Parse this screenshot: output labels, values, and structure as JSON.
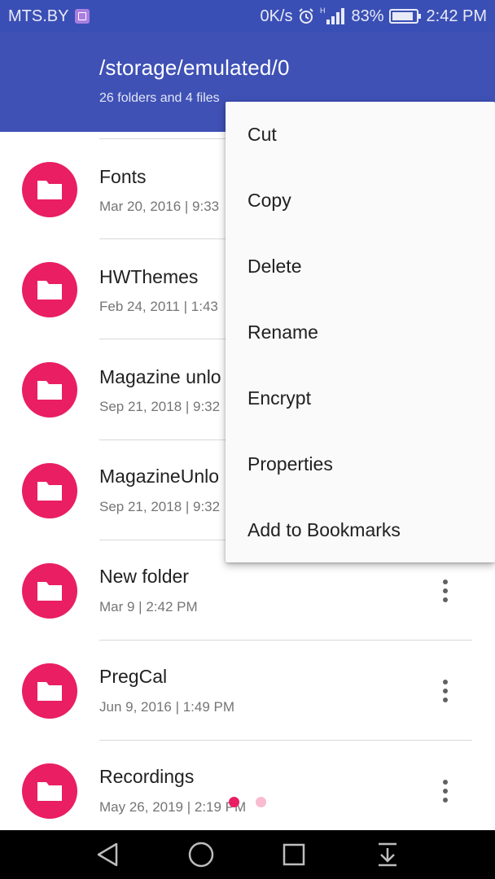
{
  "status_bar": {
    "carrier": "MTS.BY",
    "net_speed": "0K/s",
    "battery_percent": "83%",
    "time": "2:42 PM",
    "icons": [
      "gallery-icon",
      "alarm-icon",
      "signal-icon",
      "battery-icon"
    ]
  },
  "app_bar": {
    "path": "/storage/emulated/0",
    "summary": "26 folders and 4 files"
  },
  "colors": {
    "app_bar": "#3f51b5",
    "status_bar": "#3a4fb5",
    "folder_avatar": "#e91e63",
    "page_dot_active": "#e91e63",
    "page_dot_inactive": "#f8bbd0"
  },
  "list": {
    "items": [
      {
        "name": "Fonts",
        "meta": "Mar 20, 2016 | 9:33"
      },
      {
        "name": "HWThemes",
        "meta": "Feb 24, 2011 | 1:43"
      },
      {
        "name": "Magazine unlo",
        "meta": "Sep 21, 2018 | 9:32"
      },
      {
        "name": "MagazineUnlo",
        "meta": "Sep 21, 2018 | 9:32"
      },
      {
        "name": "New folder",
        "meta": "Mar 9 | 2:42 PM"
      },
      {
        "name": "PregCal",
        "meta": "Jun 9, 2016 | 1:49 PM"
      },
      {
        "name": "Recordings",
        "meta": "May 26, 2019 | 2:19 PM"
      }
    ]
  },
  "context_menu": {
    "items": [
      "Cut",
      "Copy",
      "Delete",
      "Rename",
      "Encrypt",
      "Properties",
      "Add to Bookmarks"
    ]
  },
  "nav_bar": {
    "icons": [
      "back-icon",
      "home-icon",
      "recents-icon",
      "notification-shade-icon"
    ]
  }
}
